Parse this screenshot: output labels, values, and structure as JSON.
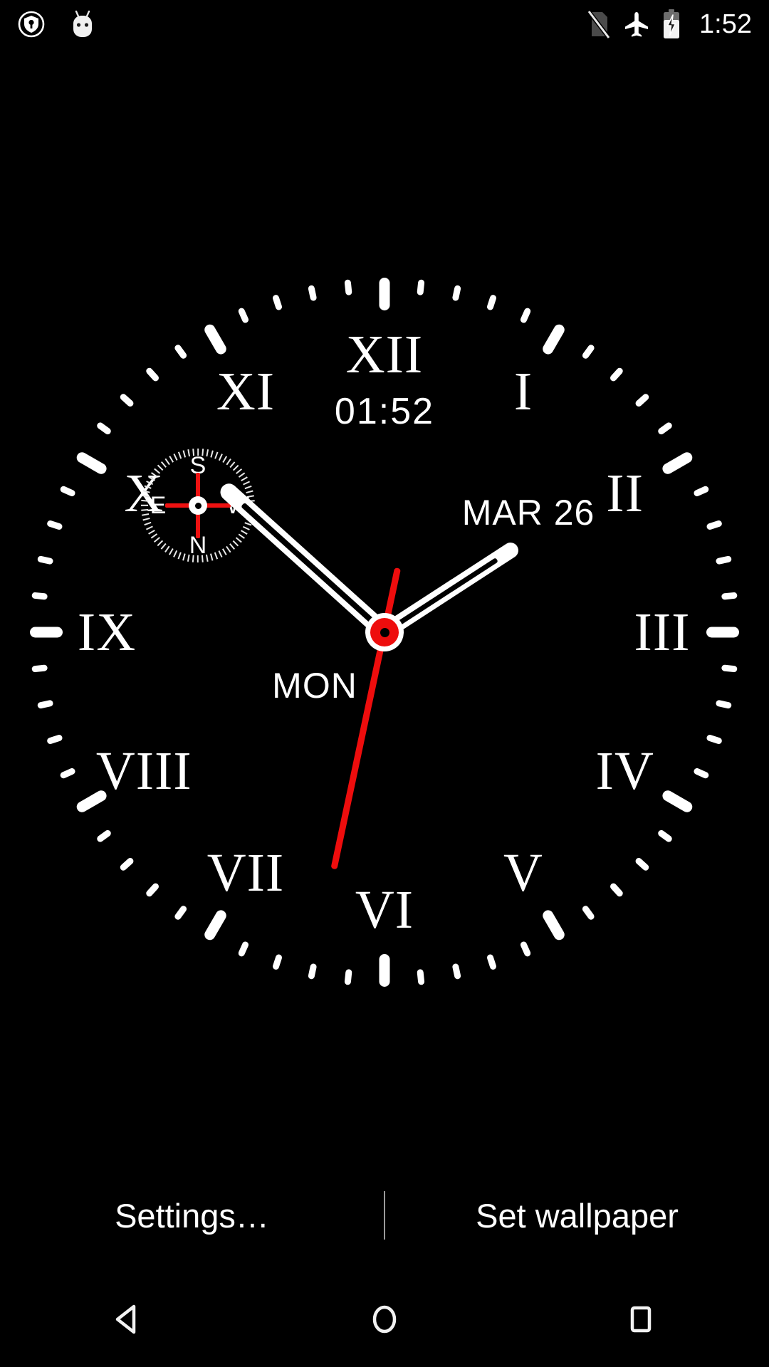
{
  "status_bar": {
    "left_icons": [
      {
        "name": "vpn-key-shield-icon",
        "label": "VPN active"
      },
      {
        "name": "android-easter-egg-icon",
        "label": "Android"
      }
    ],
    "right_icons": [
      {
        "name": "no-sim-icon",
        "label": "No SIM card"
      },
      {
        "name": "airplane-mode-icon",
        "label": "Airplane mode"
      },
      {
        "name": "battery-charging-icon",
        "label": "Charging"
      }
    ],
    "clock": "1:52"
  },
  "clock": {
    "digital_time": "01:52",
    "date": "MAR 26",
    "weekday": "MON",
    "numerals": [
      "XII",
      "I",
      "II",
      "III",
      "IV",
      "V",
      "VI",
      "VII",
      "VIII",
      "IX",
      "X",
      "XI"
    ],
    "hands": {
      "hour_angle_deg": 57,
      "minute_angle_deg": 312,
      "second_angle_deg": 192
    },
    "colors": {
      "dial": "#000000",
      "marks": "#ffffff",
      "second_hand": "#ee0d0d",
      "hub": "#ee0d0d"
    }
  },
  "compass": {
    "labels": {
      "top": "S",
      "right": "W",
      "bottom": "N",
      "left": "E"
    },
    "needle_color": "#ee1111"
  },
  "actions": {
    "settings_label": "Settings…",
    "set_wallpaper_label": "Set wallpaper"
  },
  "nav_bar": {
    "back": "back-button",
    "home": "home-button",
    "recents": "recents-button"
  }
}
